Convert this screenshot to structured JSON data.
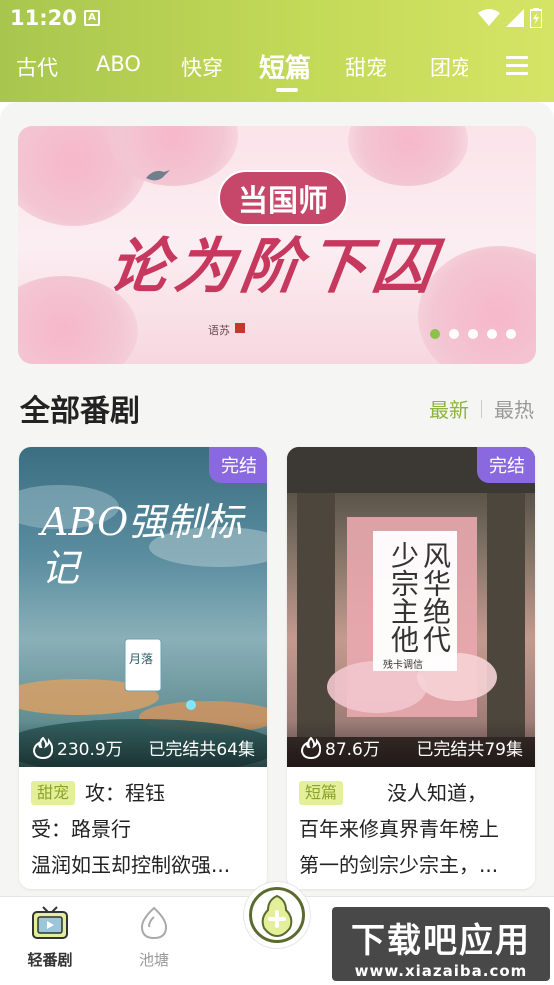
{
  "status_bar": {
    "time": "11:20",
    "notification": "A"
  },
  "tabs": [
    "古代",
    "ABO",
    "快穿",
    "短篇",
    "甜宠",
    "团宠"
  ],
  "active_tab": "短篇",
  "banner": {
    "subtitle": "当国师",
    "title": "论为阶下囚",
    "author": "语苏",
    "page_count": 5,
    "current_page": 1
  },
  "section": {
    "title": "全部番剧",
    "sort_new": "最新",
    "sort_hot": "最热"
  },
  "cards": [
    {
      "badge": "完结",
      "cover_title": "ABO强制标记",
      "cover_author": "月落",
      "heat": "230.9万",
      "episodes": "已完结共64集",
      "tag": "甜宠",
      "lines": [
        "攻：程钰",
        "受：路景行",
        "温润如玉却控制欲强..."
      ]
    },
    {
      "badge": "完结",
      "cover_title": "风华绝代少宗主他",
      "cover_author": "残卡调信",
      "heat": "87.6万",
      "episodes": "已完结共79集",
      "tag": "短篇",
      "lines": [
        "没人知道，",
        "百年来修真界青年榜上",
        "第一的剑宗少宗主，..."
      ]
    }
  ],
  "bottom_nav": {
    "tab1": "轻番剧",
    "tab2": "池塘"
  },
  "watermark": {
    "title": "下载吧应用",
    "url": "www.xiazaiba.com"
  },
  "colors": {
    "accent": "#8eb43e",
    "badge": "#8a68e0",
    "tag_bg": "#e4ef9a"
  }
}
